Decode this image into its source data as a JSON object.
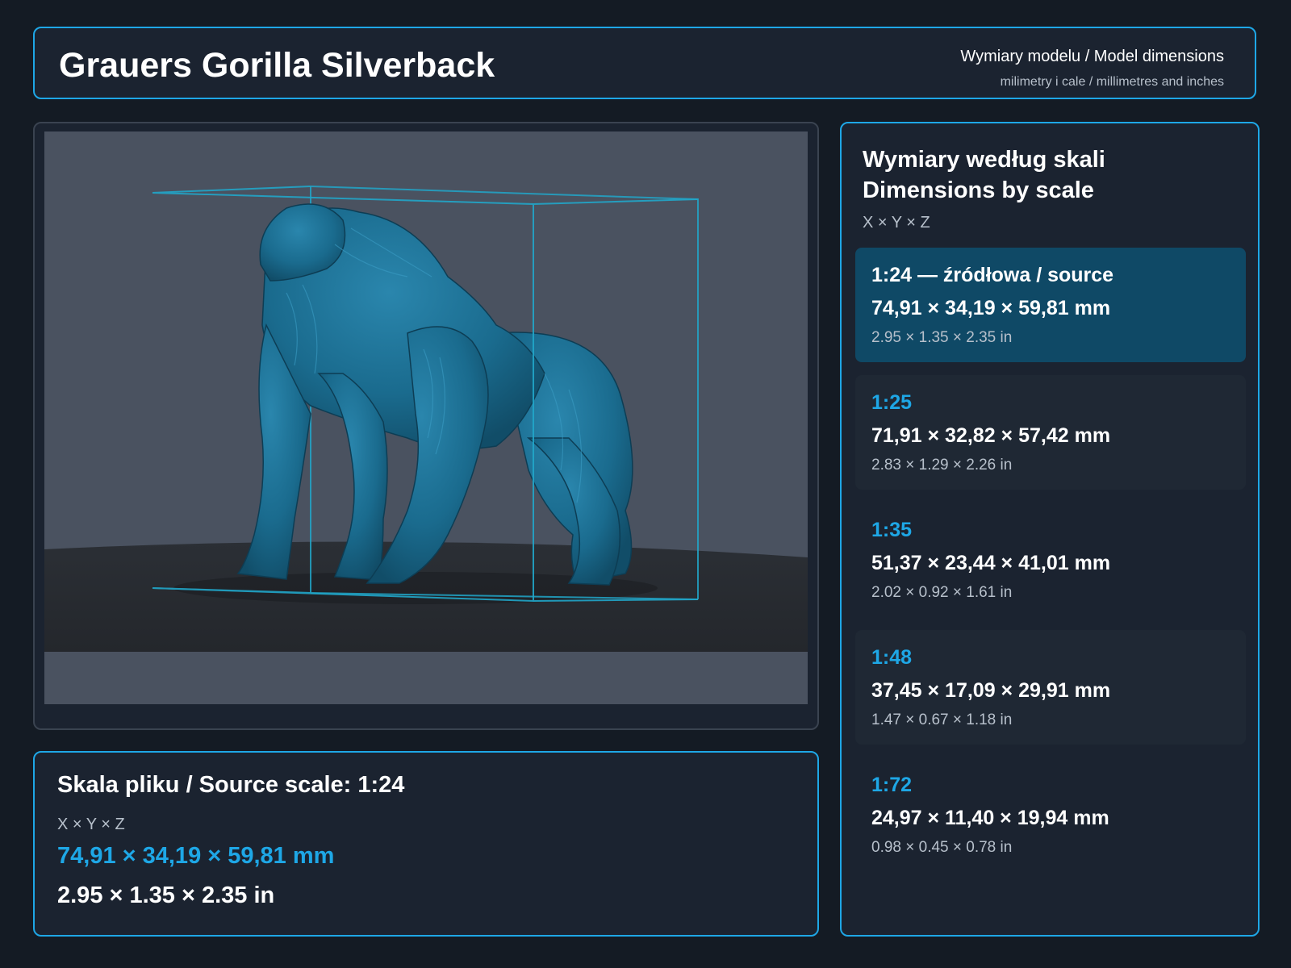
{
  "header": {
    "title": "Grauers Gorilla Silverback",
    "subtitle": "Wymiary modelu / Model dimensions",
    "subtitle_small": "milimetry i cale / millimetres and inches"
  },
  "viewer": {
    "subject": "gorilla-model-render",
    "model_color": "#1a6b8e",
    "bbox_color": "#21a6c9"
  },
  "source": {
    "title": "Skala pliku / Source scale: 1:24",
    "axes": "X × Y × Z",
    "mm": "74,91 × 34,19 × 59,81 mm",
    "inches": "2.95 × 1.35 × 2.35 in"
  },
  "scales": {
    "title_line1": "Wymiary według skali",
    "title_line2": "Dimensions by scale",
    "axes": "X × Y × Z",
    "items": [
      {
        "label": "1:24  —  źródłowa / source",
        "mm": "74,91 × 34,19 × 59,81 mm",
        "inches": "2.95 × 1.35 × 2.35 in"
      },
      {
        "label": "1:25",
        "mm": "71,91 × 32,82 × 57,42 mm",
        "inches": "2.83 × 1.29 × 2.26 in"
      },
      {
        "label": "1:35",
        "mm": "51,37 × 23,44 × 41,01 mm",
        "inches": "2.02 × 0.92 × 1.61 in"
      },
      {
        "label": "1:48",
        "mm": "37,45 × 17,09 × 29,91 mm",
        "inches": "1.47 × 0.67 × 1.18 in"
      },
      {
        "label": "1:72",
        "mm": "24,97 × 11,40 × 19,94 mm",
        "inches": "0.98 × 0.45 × 0.78 in"
      }
    ]
  },
  "colors": {
    "accent": "#1ea7e6",
    "background": "#141b24",
    "panel": "#1b2330",
    "active_card": "#0f4966"
  }
}
